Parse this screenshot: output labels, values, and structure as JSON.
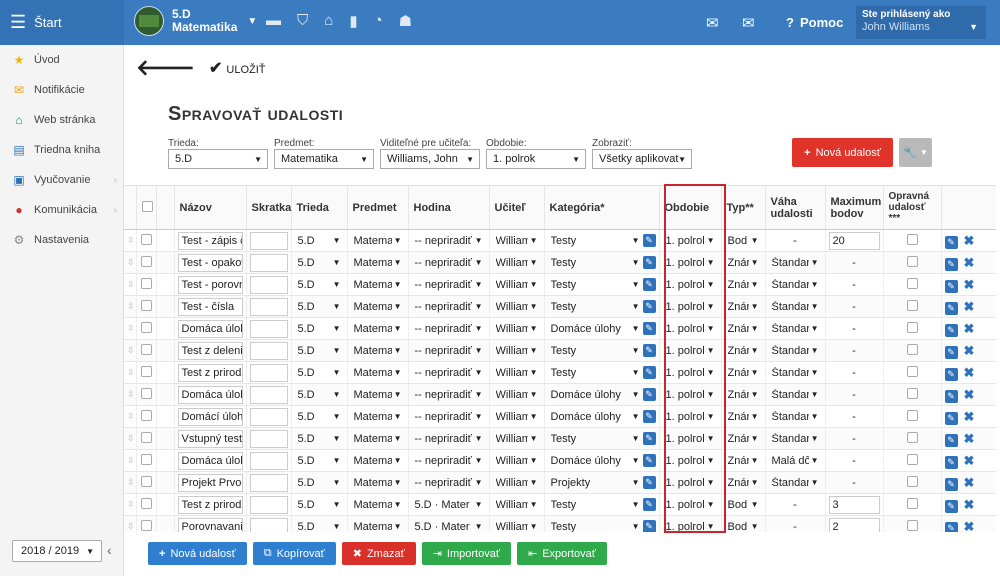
{
  "topbar": {
    "menu_label": "Štart",
    "class_name": "5.D",
    "subject": "Matematika",
    "help": "Pomoc",
    "user_label": "Ste prihlásený ako",
    "user_name": "John Williams",
    "icons": [
      "cards-icon",
      "shield-icon",
      "bank-icon",
      "chart-icon",
      "gauge-icon",
      "people-icon"
    ]
  },
  "sidebar": {
    "items": [
      {
        "label": "Úvod",
        "icon": "star-icon"
      },
      {
        "label": "Notifikácie",
        "icon": "mail-icon"
      },
      {
        "label": "Web stránka",
        "icon": "home-icon"
      },
      {
        "label": "Triedna kniha",
        "icon": "book-icon"
      },
      {
        "label": "Vyučovanie",
        "icon": "bag-icon"
      },
      {
        "label": "Komunikácia",
        "icon": "chat-icon"
      },
      {
        "label": "Nastavenia",
        "icon": "gear-icon"
      }
    ],
    "year": "2018 / 2019"
  },
  "toolbar": {
    "save_label": "ULOŽIŤ"
  },
  "page": {
    "title": "Spravovať udalosti"
  },
  "filters": [
    {
      "label": "Trieda:",
      "value": "5.D"
    },
    {
      "label": "Predmet:",
      "value": "Matematika"
    },
    {
      "label": "Viditeľné pre učiteľa:",
      "value": "Williams, John"
    },
    {
      "label": "Obdobie:",
      "value": "1. polrok"
    },
    {
      "label": "Zobraziť:",
      "value": "Všetky aplikovat"
    }
  ],
  "buttons": {
    "new_event_top": "Nová udalosť",
    "new_event": "Nová udalosť",
    "copy": "Kopírovať",
    "delete": "Zmazať",
    "import": "Importovať",
    "export": "Exportovať"
  },
  "table": {
    "headers": [
      "Názov",
      "Skratka",
      "Trieda",
      "Predmet",
      "Hodina",
      "Učiteľ",
      "Kategória*",
      "Obdobie",
      "Typ**",
      "Váha udalosti",
      "Maximum bodov",
      "Opravná udalosť ***"
    ],
    "rows": [
      {
        "name": "Test - zápis čís",
        "cls": "5.D",
        "subject": "Matemat",
        "hour": "-- nepriradiť",
        "teacher": "William",
        "category": "Testy",
        "period": "1. polrol",
        "type": "Bod",
        "weight": "-",
        "max": "20"
      },
      {
        "name": "Test - opakova",
        "cls": "5.D",
        "subject": "Matemat",
        "hour": "-- nepriradiť",
        "teacher": "William",
        "category": "Testy",
        "period": "1. polrol",
        "type": "Znár",
        "weight": "Štandar",
        "max": "-"
      },
      {
        "name": "Test - porovná",
        "cls": "5.D",
        "subject": "Matemat",
        "hour": "-- nepriradiť",
        "teacher": "William",
        "category": "Testy",
        "period": "1. polrol",
        "type": "Znár",
        "weight": "Štandar",
        "max": "-"
      },
      {
        "name": "Test - čísla",
        "cls": "5.D",
        "subject": "Matemat",
        "hour": "-- nepriradiť",
        "teacher": "William",
        "category": "Testy",
        "period": "1. polrol",
        "type": "Znár",
        "weight": "Štandar",
        "max": "-"
      },
      {
        "name": "Domáca úloha",
        "cls": "5.D",
        "subject": "Matemat",
        "hour": "-- nepriradiť",
        "teacher": "William",
        "category": "Domáce úlohy",
        "period": "1. polrol",
        "type": "Znár",
        "weight": "Štandar",
        "max": "-"
      },
      {
        "name": "Test z delenia",
        "cls": "5.D",
        "subject": "Matemat",
        "hour": "-- nepriradiť",
        "teacher": "William",
        "category": "Testy",
        "period": "1. polrol",
        "type": "Znár",
        "weight": "Štandar",
        "max": "-"
      },
      {
        "name": "Test z prirodze",
        "cls": "5.D",
        "subject": "Matemat",
        "hour": "-- nepriradiť",
        "teacher": "William",
        "category": "Testy",
        "period": "1. polrol",
        "type": "Znár",
        "weight": "Štandar",
        "max": "-"
      },
      {
        "name": "Domáca úloha",
        "cls": "5.D",
        "subject": "Matemat",
        "hour": "-- nepriradiť",
        "teacher": "William",
        "category": "Domáce úlohy",
        "period": "1. polrol",
        "type": "Znár",
        "weight": "Štandar",
        "max": "-"
      },
      {
        "name": "Domácí úloha",
        "cls": "5.D",
        "subject": "Matemat",
        "hour": "-- nepriradiť",
        "teacher": "William",
        "category": "Domáce úlohy",
        "period": "1. polrol",
        "type": "Znár",
        "weight": "Štandar",
        "max": "-"
      },
      {
        "name": "Vstupný test",
        "cls": "5.D",
        "subject": "Matemat",
        "hour": "-- nepriradiť",
        "teacher": "William",
        "category": "Testy",
        "period": "1. polrol",
        "type": "Znár",
        "weight": "Štandar",
        "max": "-"
      },
      {
        "name": "Domáca úloha",
        "cls": "5.D",
        "subject": "Matemat",
        "hour": "-- nepriradiť",
        "teacher": "William",
        "category": "Domáce úlohy",
        "period": "1. polrol",
        "type": "Znár",
        "weight": "Malá dô",
        "max": "-"
      },
      {
        "name": "Projekt Prvočí",
        "cls": "5.D",
        "subject": "Matemat",
        "hour": "-- nepriradiť",
        "teacher": "William",
        "category": "Projekty",
        "period": "1. polrol",
        "type": "Znár",
        "weight": "Štandar",
        "max": "-"
      },
      {
        "name": "Test z prirodze",
        "cls": "5.D",
        "subject": "Matemat",
        "hour": "5.D · Mater",
        "teacher": "William",
        "category": "Testy",
        "period": "1. polrol",
        "type": "Bod",
        "weight": "-",
        "max": "3"
      },
      {
        "name": "Porovnavanie",
        "cls": "5.D",
        "subject": "Matemat",
        "hour": "5.D · Mater",
        "teacher": "William",
        "category": "Testy",
        "period": "1. polrol",
        "type": "Bod",
        "weight": "-",
        "max": "2"
      }
    ]
  }
}
